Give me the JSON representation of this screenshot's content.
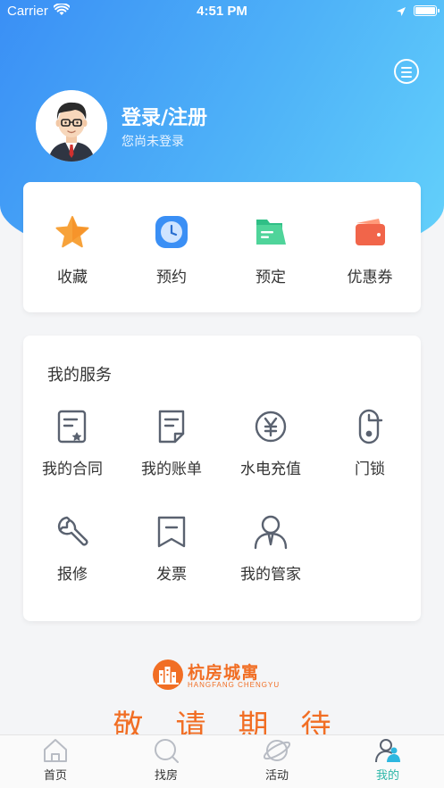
{
  "status_bar": {
    "carrier": "Carrier",
    "time": "4:51 PM"
  },
  "profile": {
    "title": "登录/注册",
    "subtitle": "您尚未登录",
    "avatar_icon": "user-avatar"
  },
  "header": {
    "message_icon": "message-icon"
  },
  "quick_actions": [
    {
      "label": "收藏",
      "icon": "star-icon",
      "color": "#f7a23a"
    },
    {
      "label": "预约",
      "icon": "clock-icon",
      "color": "#3a8ff5"
    },
    {
      "label": "预定",
      "icon": "folder-icon",
      "color": "#3cc58a"
    },
    {
      "label": "优惠券",
      "icon": "wallet-icon",
      "color": "#f1654a"
    }
  ],
  "services": {
    "title": "我的服务",
    "items": [
      {
        "label": "我的合同",
        "icon": "contract-icon"
      },
      {
        "label": "我的账单",
        "icon": "bill-icon"
      },
      {
        "label": "水电充值",
        "icon": "yuan-icon"
      },
      {
        "label": "门锁",
        "icon": "lock-icon"
      },
      {
        "label": "报修",
        "icon": "wrench-icon"
      },
      {
        "label": "发票",
        "icon": "invoice-icon"
      },
      {
        "label": "我的管家",
        "icon": "butler-icon"
      }
    ]
  },
  "brand": {
    "name": "杭房城寓",
    "name_en": "HANGFANG CHENGYU",
    "slogan": "敬请期待",
    "color": "#f16e24"
  },
  "tabbar": [
    {
      "label": "首页",
      "icon": "home-icon"
    },
    {
      "label": "找房",
      "icon": "search-icon"
    },
    {
      "label": "活动",
      "icon": "planet-icon"
    },
    {
      "label": "我的",
      "icon": "profile-icon",
      "active": true
    }
  ]
}
